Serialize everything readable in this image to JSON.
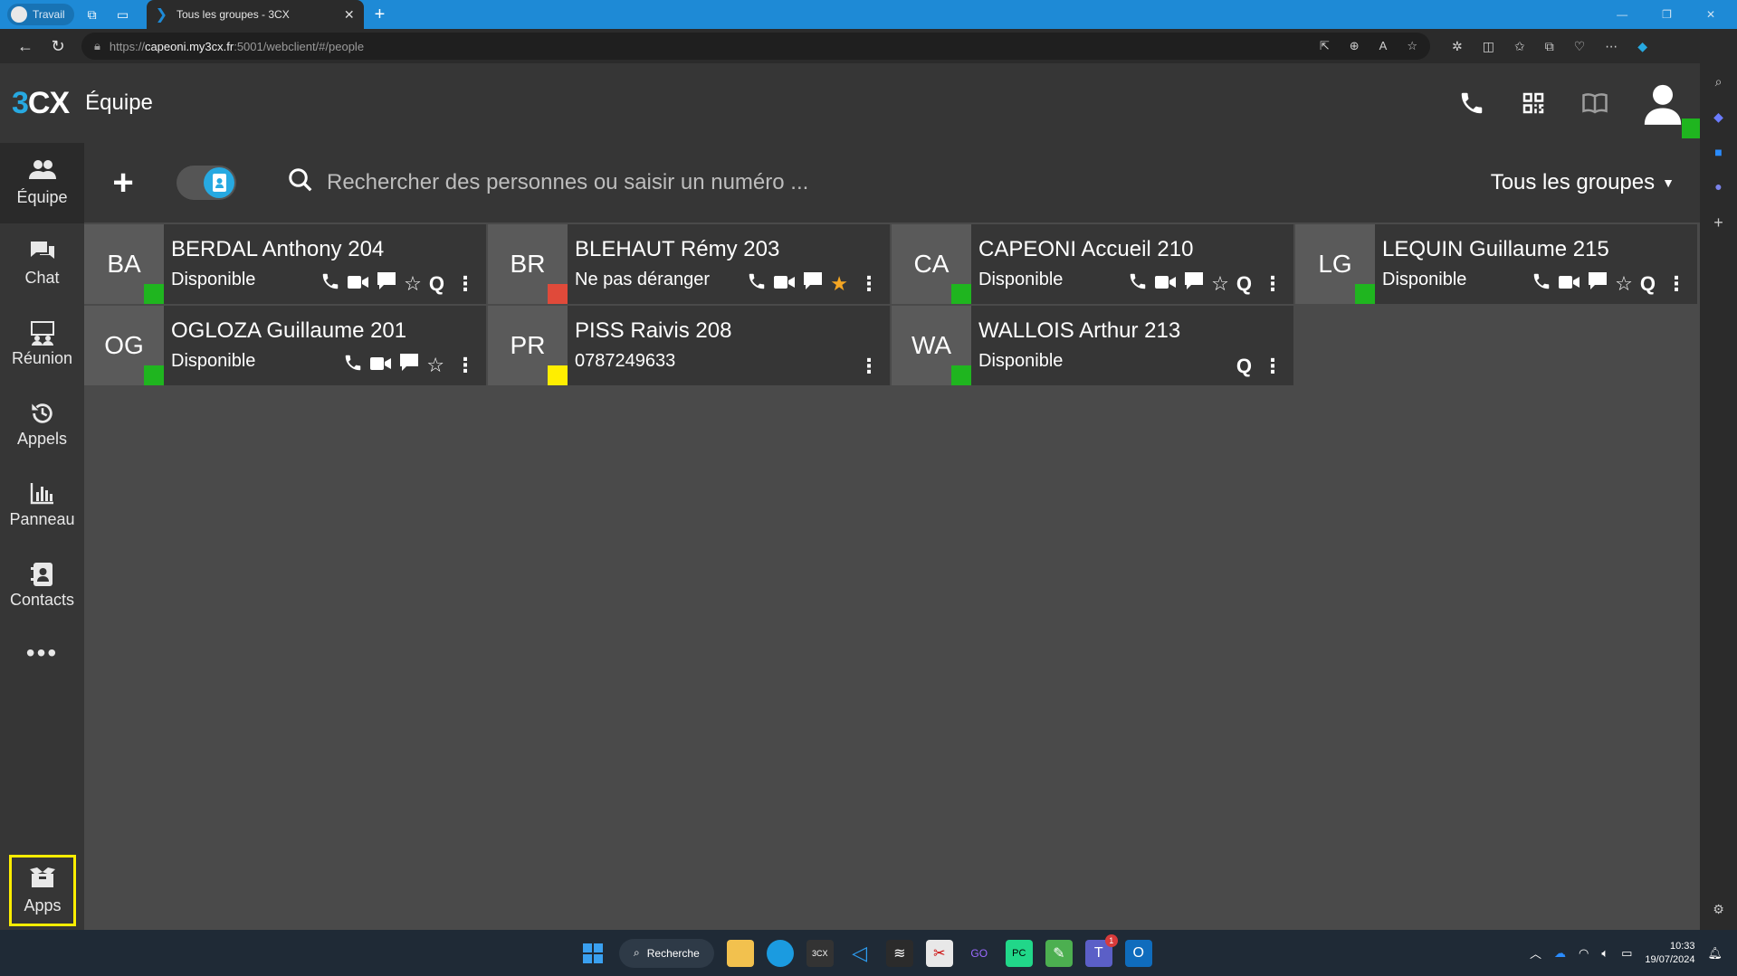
{
  "browser": {
    "profile_label": "Travail",
    "tab_title": "Tous les groupes - 3CX",
    "url_prefix": "https://",
    "url_host": "capeoni.my3cx.fr",
    "url_path": ":5001/webclient/#/people"
  },
  "header": {
    "logo_a": "3",
    "logo_b": "CX",
    "title": "Équipe"
  },
  "nav": {
    "items": [
      {
        "label": "Équipe",
        "icon": "team-icon"
      },
      {
        "label": "Chat",
        "icon": "chat-icon"
      },
      {
        "label": "Réunion",
        "icon": "meeting-icon"
      },
      {
        "label": "Appels",
        "icon": "history-icon"
      },
      {
        "label": "Panneau",
        "icon": "panel-icon"
      },
      {
        "label": "Contacts",
        "icon": "contacts-icon"
      }
    ],
    "more": "•••",
    "apps_label": "Apps"
  },
  "toolbar": {
    "search_placeholder": "Rechercher des personnes ou saisir un numéro ...",
    "groups_label": "Tous les groupes"
  },
  "colors": {
    "available": "#1fb51f",
    "dnd": "#e04a3a",
    "away": "#ffee00",
    "accent": "#27a9e1",
    "star": "#f5a623"
  },
  "contacts": [
    {
      "initials": "BA",
      "name": "BERDAL Anthony 204",
      "status": "Disponible"
    },
    {
      "initials": "BR",
      "name": "BLEHAUT Rémy 203",
      "status": "Ne pas déranger"
    },
    {
      "initials": "CA",
      "name": "CAPEONI Accueil 210",
      "status": "Disponible"
    },
    {
      "initials": "LG",
      "name": "LEQUIN Guillaume 215",
      "status": "Disponible"
    },
    {
      "initials": "OG",
      "name": "OGLOZA Guillaume 201",
      "status": "Disponible"
    },
    {
      "initials": "PR",
      "name": "PISS Raivis 208",
      "status": "0787249633"
    },
    {
      "initials": "WA",
      "name": "WALLOIS Arthur 213",
      "status": "Disponible"
    }
  ],
  "taskbar": {
    "search_label": "Recherche",
    "time": "10:33",
    "date": "19/07/2024",
    "badge": "1"
  }
}
